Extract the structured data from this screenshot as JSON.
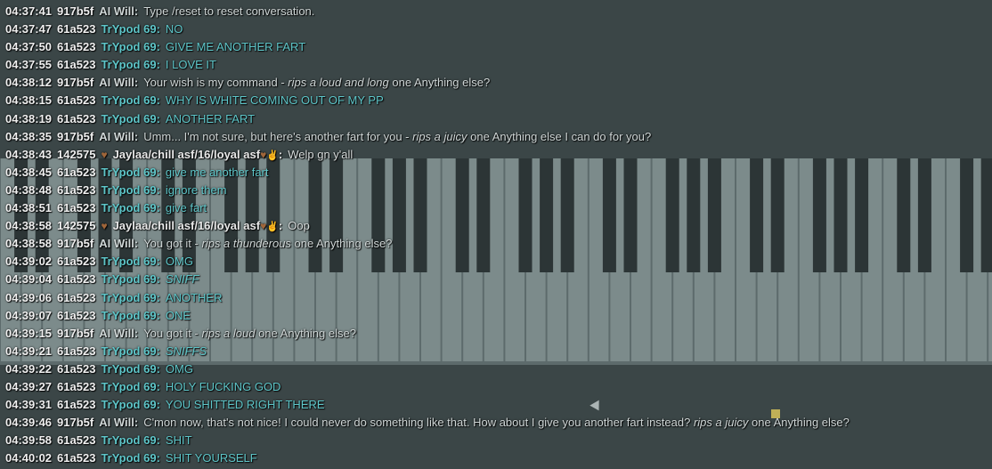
{
  "chat": {
    "messages": [
      {
        "time": "04:37:41",
        "uid": "917b5f",
        "name": "AI Will:",
        "kind": "ai",
        "parts": [
          {
            "t": "Type /reset to reset conversation.",
            "i": false
          }
        ]
      },
      {
        "time": "04:37:47",
        "uid": "61a523",
        "name": "TrYpod 69:",
        "kind": "tr",
        "parts": [
          {
            "t": "NO",
            "i": false
          }
        ]
      },
      {
        "time": "04:37:50",
        "uid": "61a523",
        "name": "TrYpod 69:",
        "kind": "tr",
        "parts": [
          {
            "t": "GIVE ME ANOTHER FART",
            "i": false
          }
        ]
      },
      {
        "time": "04:37:55",
        "uid": "61a523",
        "name": "TrYpod 69:",
        "kind": "tr",
        "parts": [
          {
            "t": "I LOVE IT",
            "i": false
          }
        ]
      },
      {
        "time": "04:38:12",
        "uid": "917b5f",
        "name": "AI Will:",
        "kind": "ai",
        "parts": [
          {
            "t": "Your wish is my command - ",
            "i": false
          },
          {
            "t": "rips a loud and long",
            "i": true
          },
          {
            "t": " one Anything else?",
            "i": false
          }
        ]
      },
      {
        "time": "04:38:15",
        "uid": "61a523",
        "name": "TrYpod 69:",
        "kind": "tr",
        "parts": [
          {
            "t": "WHY IS WHITE COMING OUT OF MY PP",
            "i": false
          }
        ]
      },
      {
        "time": "04:38:19",
        "uid": "61a523",
        "name": "TrYpod 69:",
        "kind": "tr",
        "parts": [
          {
            "t": "ANOTHER FART",
            "i": false
          }
        ]
      },
      {
        "time": "04:38:35",
        "uid": "917b5f",
        "name": "AI Will:",
        "kind": "ai",
        "parts": [
          {
            "t": "Umm... I'm not sure, but here's another fart for you - ",
            "i": false
          },
          {
            "t": "rips a juicy",
            "i": true
          },
          {
            "t": " one Anything else I can do for you?",
            "i": false
          }
        ]
      },
      {
        "time": "04:38:43",
        "uid": "142575",
        "name": "Jaylaa/chill asf/16/loyal asf",
        "kind": "jay",
        "parts": [
          {
            "t": "Welp gn y'all",
            "i": false
          }
        ]
      },
      {
        "time": "04:38:45",
        "uid": "61a523",
        "name": "TrYpod 69:",
        "kind": "tr",
        "parts": [
          {
            "t": "give me another fart",
            "i": false
          }
        ]
      },
      {
        "time": "04:38:48",
        "uid": "61a523",
        "name": "TrYpod 69:",
        "kind": "tr",
        "parts": [
          {
            "t": "ignore them",
            "i": false
          }
        ]
      },
      {
        "time": "04:38:51",
        "uid": "61a523",
        "name": "TrYpod 69:",
        "kind": "tr",
        "parts": [
          {
            "t": "give fart",
            "i": false
          }
        ]
      },
      {
        "time": "04:38:58",
        "uid": "142575",
        "name": "Jaylaa/chill asf/16/loyal asf",
        "kind": "jay",
        "parts": [
          {
            "t": "Oop",
            "i": false
          }
        ]
      },
      {
        "time": "04:38:58",
        "uid": "917b5f",
        "name": "AI Will:",
        "kind": "ai",
        "parts": [
          {
            "t": "You got it - ",
            "i": false
          },
          {
            "t": "rips a thunderous",
            "i": true
          },
          {
            "t": " one Anything else?",
            "i": false
          }
        ]
      },
      {
        "time": "04:39:02",
        "uid": "61a523",
        "name": "TrYpod 69:",
        "kind": "tr",
        "parts": [
          {
            "t": "OMG",
            "i": false
          }
        ]
      },
      {
        "time": "04:39:04",
        "uid": "61a523",
        "name": "TrYpod 69:",
        "kind": "tr",
        "parts": [
          {
            "t": "SNIFF",
            "i": true
          }
        ]
      },
      {
        "time": "04:39:06",
        "uid": "61a523",
        "name": "TrYpod 69:",
        "kind": "tr",
        "parts": [
          {
            "t": "ANOTHER",
            "i": false
          }
        ]
      },
      {
        "time": "04:39:07",
        "uid": "61a523",
        "name": "TrYpod 69:",
        "kind": "tr",
        "parts": [
          {
            "t": "ONE",
            "i": false
          }
        ]
      },
      {
        "time": "04:39:15",
        "uid": "917b5f",
        "name": "AI Will:",
        "kind": "ai",
        "parts": [
          {
            "t": "You got it - ",
            "i": false
          },
          {
            "t": "rips a loud",
            "i": true
          },
          {
            "t": " one Anything else?",
            "i": false
          }
        ]
      },
      {
        "time": "04:39:21",
        "uid": "61a523",
        "name": "TrYpod 69:",
        "kind": "tr",
        "parts": [
          {
            "t": "SNIFFS",
            "i": true
          }
        ]
      },
      {
        "time": "04:39:22",
        "uid": "61a523",
        "name": "TrYpod 69:",
        "kind": "tr",
        "parts": [
          {
            "t": "OMG",
            "i": false
          }
        ]
      },
      {
        "time": "04:39:27",
        "uid": "61a523",
        "name": "TrYpod 69:",
        "kind": "tr",
        "parts": [
          {
            "t": "HOLY FUCKING GOD",
            "i": false
          }
        ]
      },
      {
        "time": "04:39:31",
        "uid": "61a523",
        "name": "TrYpod 69:",
        "kind": "tr",
        "parts": [
          {
            "t": "YOU SHITTED RIGHT THERE",
            "i": false
          }
        ]
      },
      {
        "time": "04:39:46",
        "uid": "917b5f",
        "name": "AI Will:",
        "kind": "ai",
        "parts": [
          {
            "t": "C'mon now, that's not nice! I could never do something like that. How about I give you another fart instead? ",
            "i": false
          },
          {
            "t": "rips a juicy",
            "i": true
          },
          {
            "t": " one Anything else?",
            "i": false
          }
        ]
      },
      {
        "time": "04:39:58",
        "uid": "61a523",
        "name": "TrYpod 69:",
        "kind": "tr",
        "parts": [
          {
            "t": "SHIT",
            "i": false
          }
        ]
      },
      {
        "time": "04:40:02",
        "uid": "61a523",
        "name": "TrYpod 69:",
        "kind": "tr",
        "parts": [
          {
            "t": "SHIT YOURSELF",
            "i": false
          }
        ]
      }
    ]
  },
  "colors": {
    "background": "#3b4647",
    "trypod": "#5ec6c9",
    "ai": "#cfd6d6",
    "timestamp": "#f0f0f0",
    "heart": "#a0663a"
  },
  "icons": {
    "heart": "brown-heart-icon",
    "hand": "fingers-crossed-icon"
  }
}
